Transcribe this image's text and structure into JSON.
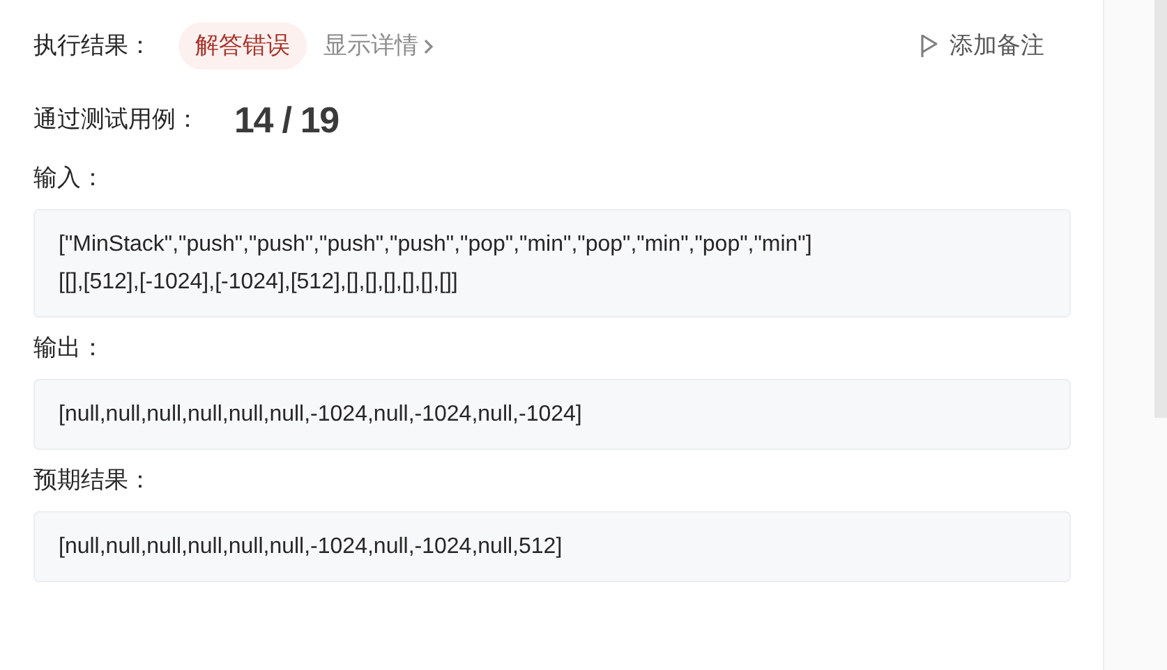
{
  "result": {
    "label": "执行结果：",
    "status": "解答错误",
    "details_link": "显示详情",
    "note_button": "添加备注"
  },
  "passed": {
    "label": "通过测试用例：",
    "count": "14 / 19"
  },
  "sections": [
    {
      "label": "输入：",
      "lines": [
        "[\"MinStack\",\"push\",\"push\",\"push\",\"push\",\"pop\",\"min\",\"pop\",\"min\",\"pop\",\"min\"]",
        "[[],[512],[-1024],[-1024],[512],[],[],[],[],[],[]]"
      ]
    },
    {
      "label": "输出：",
      "lines": [
        "[null,null,null,null,null,null,-1024,null,-1024,null,-1024]"
      ]
    },
    {
      "label": "预期结果：",
      "lines": [
        "[null,null,null,null,null,null,-1024,null,-1024,null,512]"
      ]
    }
  ]
}
